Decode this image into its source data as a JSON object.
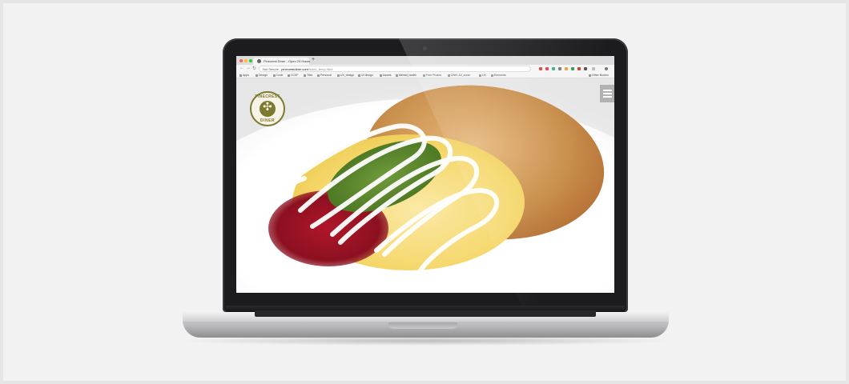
{
  "browser": {
    "tab_title": "Pinecrest Diner - Open 24 Hours",
    "tab_close": "×",
    "new_tab": "+",
    "address": {
      "security": "Not Secure",
      "host": "pinecrestdiner.com",
      "path": "/index_temp.html"
    },
    "bookmarks": [
      "Apps",
      "Design",
      "Code",
      "CCSF",
      "Tiles",
      "Personal",
      "UX_design",
      "UI design",
      "Assets",
      "Mental_health",
      "Free Photos",
      "UNIX-A2_zoom",
      "UX",
      "Elements"
    ],
    "other_bookmarks": "Other Bookm",
    "nav": {
      "back": "←",
      "forward": "→",
      "reload": "↻"
    },
    "colors": {
      "close": "#ff5f57",
      "minimize": "#febc2e",
      "maximize": "#28c840"
    }
  },
  "site": {
    "logo": {
      "top_text": "PINECREST",
      "bottom_text": "DINER",
      "mark": "✣"
    },
    "menu_icon": "hamburger-icon",
    "hero_image": "omelette with avocado, sour cream, salsa and hash browns"
  }
}
